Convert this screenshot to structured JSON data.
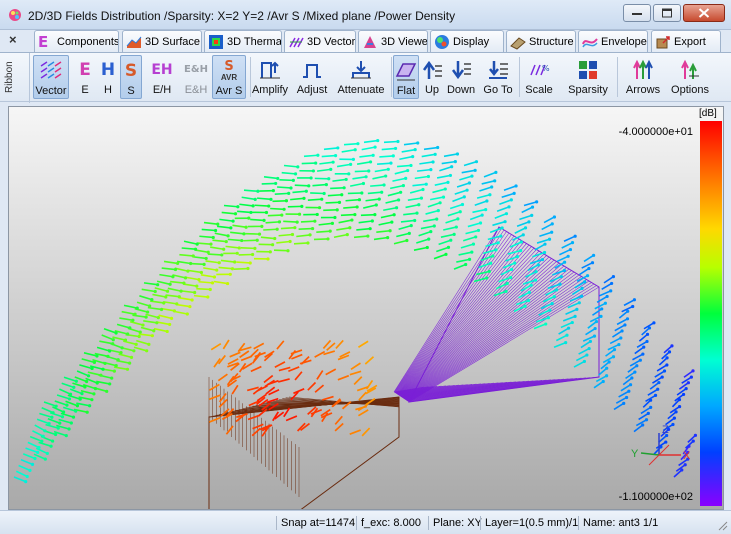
{
  "window": {
    "title": "2D/3D Fields Distribution /Sparsity:  X=2 Y=2 /Avr S /Mixed plane /Power Density"
  },
  "tabs": [
    {
      "label": "Components",
      "icon": "components-icon"
    },
    {
      "label": "3D Surface",
      "icon": "surface-icon"
    },
    {
      "label": "3D Therma",
      "icon": "thermal-icon"
    },
    {
      "label": "3D Vector",
      "icon": "vector-icon",
      "active": true
    },
    {
      "label": "3D Viewer",
      "icon": "viewer-icon"
    },
    {
      "label": "Display",
      "icon": "display-icon"
    },
    {
      "label": "Structure",
      "icon": "structure-icon"
    },
    {
      "label": "Envelope",
      "icon": "envelope-icon"
    },
    {
      "label": "Export",
      "icon": "export-icon"
    }
  ],
  "ribbon": {
    "side_label": "Ribbon",
    "buttons": {
      "vector": "Vector",
      "e": "E",
      "h": "H",
      "s": "S",
      "eh_dropdown": "E/H",
      "e_and_h": "E&H",
      "avr_s": "Avr S",
      "amplify": "Amplify",
      "adjust": "Adjust",
      "attenuate": "Attenuate",
      "flat": "Flat",
      "up": "Up",
      "down": "Down",
      "goto": "Go To",
      "scale": "Scale",
      "sparsity": "Sparsity",
      "arrows": "Arrows",
      "options": "Options"
    },
    "icon_letters": {
      "e": "E",
      "h": "H",
      "s": "S",
      "eh": "EH",
      "eh_amp": "E&H",
      "avr_s": "S",
      "avr": "AVR"
    }
  },
  "colorbar": {
    "unit": "[dB]",
    "max": "-4.000000e+01",
    "min": "-1.100000e+02"
  },
  "axes": {
    "x": "X",
    "y": "Y",
    "z": "Z"
  },
  "status": {
    "snap": "Snap at=11474",
    "fexc": "f_exc:  8.000",
    "plane": "Plane: XY",
    "layer": "Layer=1(0.5 mm)/1",
    "name": "Name: ant3 1/1"
  },
  "colors": {
    "accent": "#3c7fd4",
    "high_field": "#ff0000",
    "low_field": "#8a00ff",
    "structure_lines": "#6a2c10",
    "horn_lines": "#7a1fd6"
  }
}
